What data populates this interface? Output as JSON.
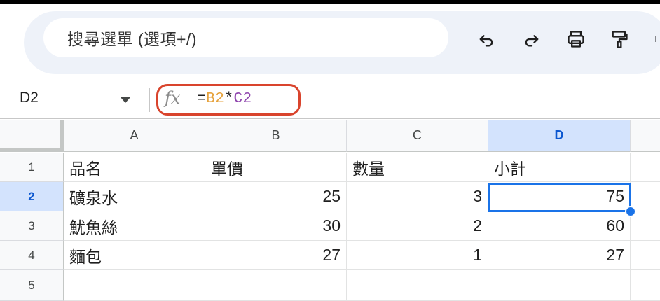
{
  "toolbar": {
    "search_placeholder": "搜尋選單 (選項+/)",
    "icons": [
      "undo-icon",
      "redo-icon",
      "print-icon",
      "paint-format-icon"
    ]
  },
  "formula_bar": {
    "name_box": "D2",
    "formula_eq": "=",
    "formula_ref1": "B2",
    "formula_op": "*",
    "formula_ref2": "C2"
  },
  "colors": {
    "accent": "#1a73e8",
    "highlight": "#d9442d",
    "ref1": "#e6a23c",
    "ref2": "#8e44ad",
    "selected_header": "#d3e3fd"
  },
  "sheet": {
    "columns": [
      "A",
      "B",
      "C",
      "D"
    ],
    "row_numbers": [
      "1",
      "2",
      "3",
      "4",
      "5"
    ],
    "rows": [
      [
        "品名",
        "單價",
        "數量",
        "小計"
      ],
      [
        "礦泉水",
        "25",
        "3",
        "75"
      ],
      [
        "魷魚絲",
        "30",
        "2",
        "60"
      ],
      [
        "麵包",
        "27",
        "1",
        "27"
      ],
      [
        "",
        "",
        "",
        ""
      ]
    ],
    "selected_cell": "D2"
  }
}
